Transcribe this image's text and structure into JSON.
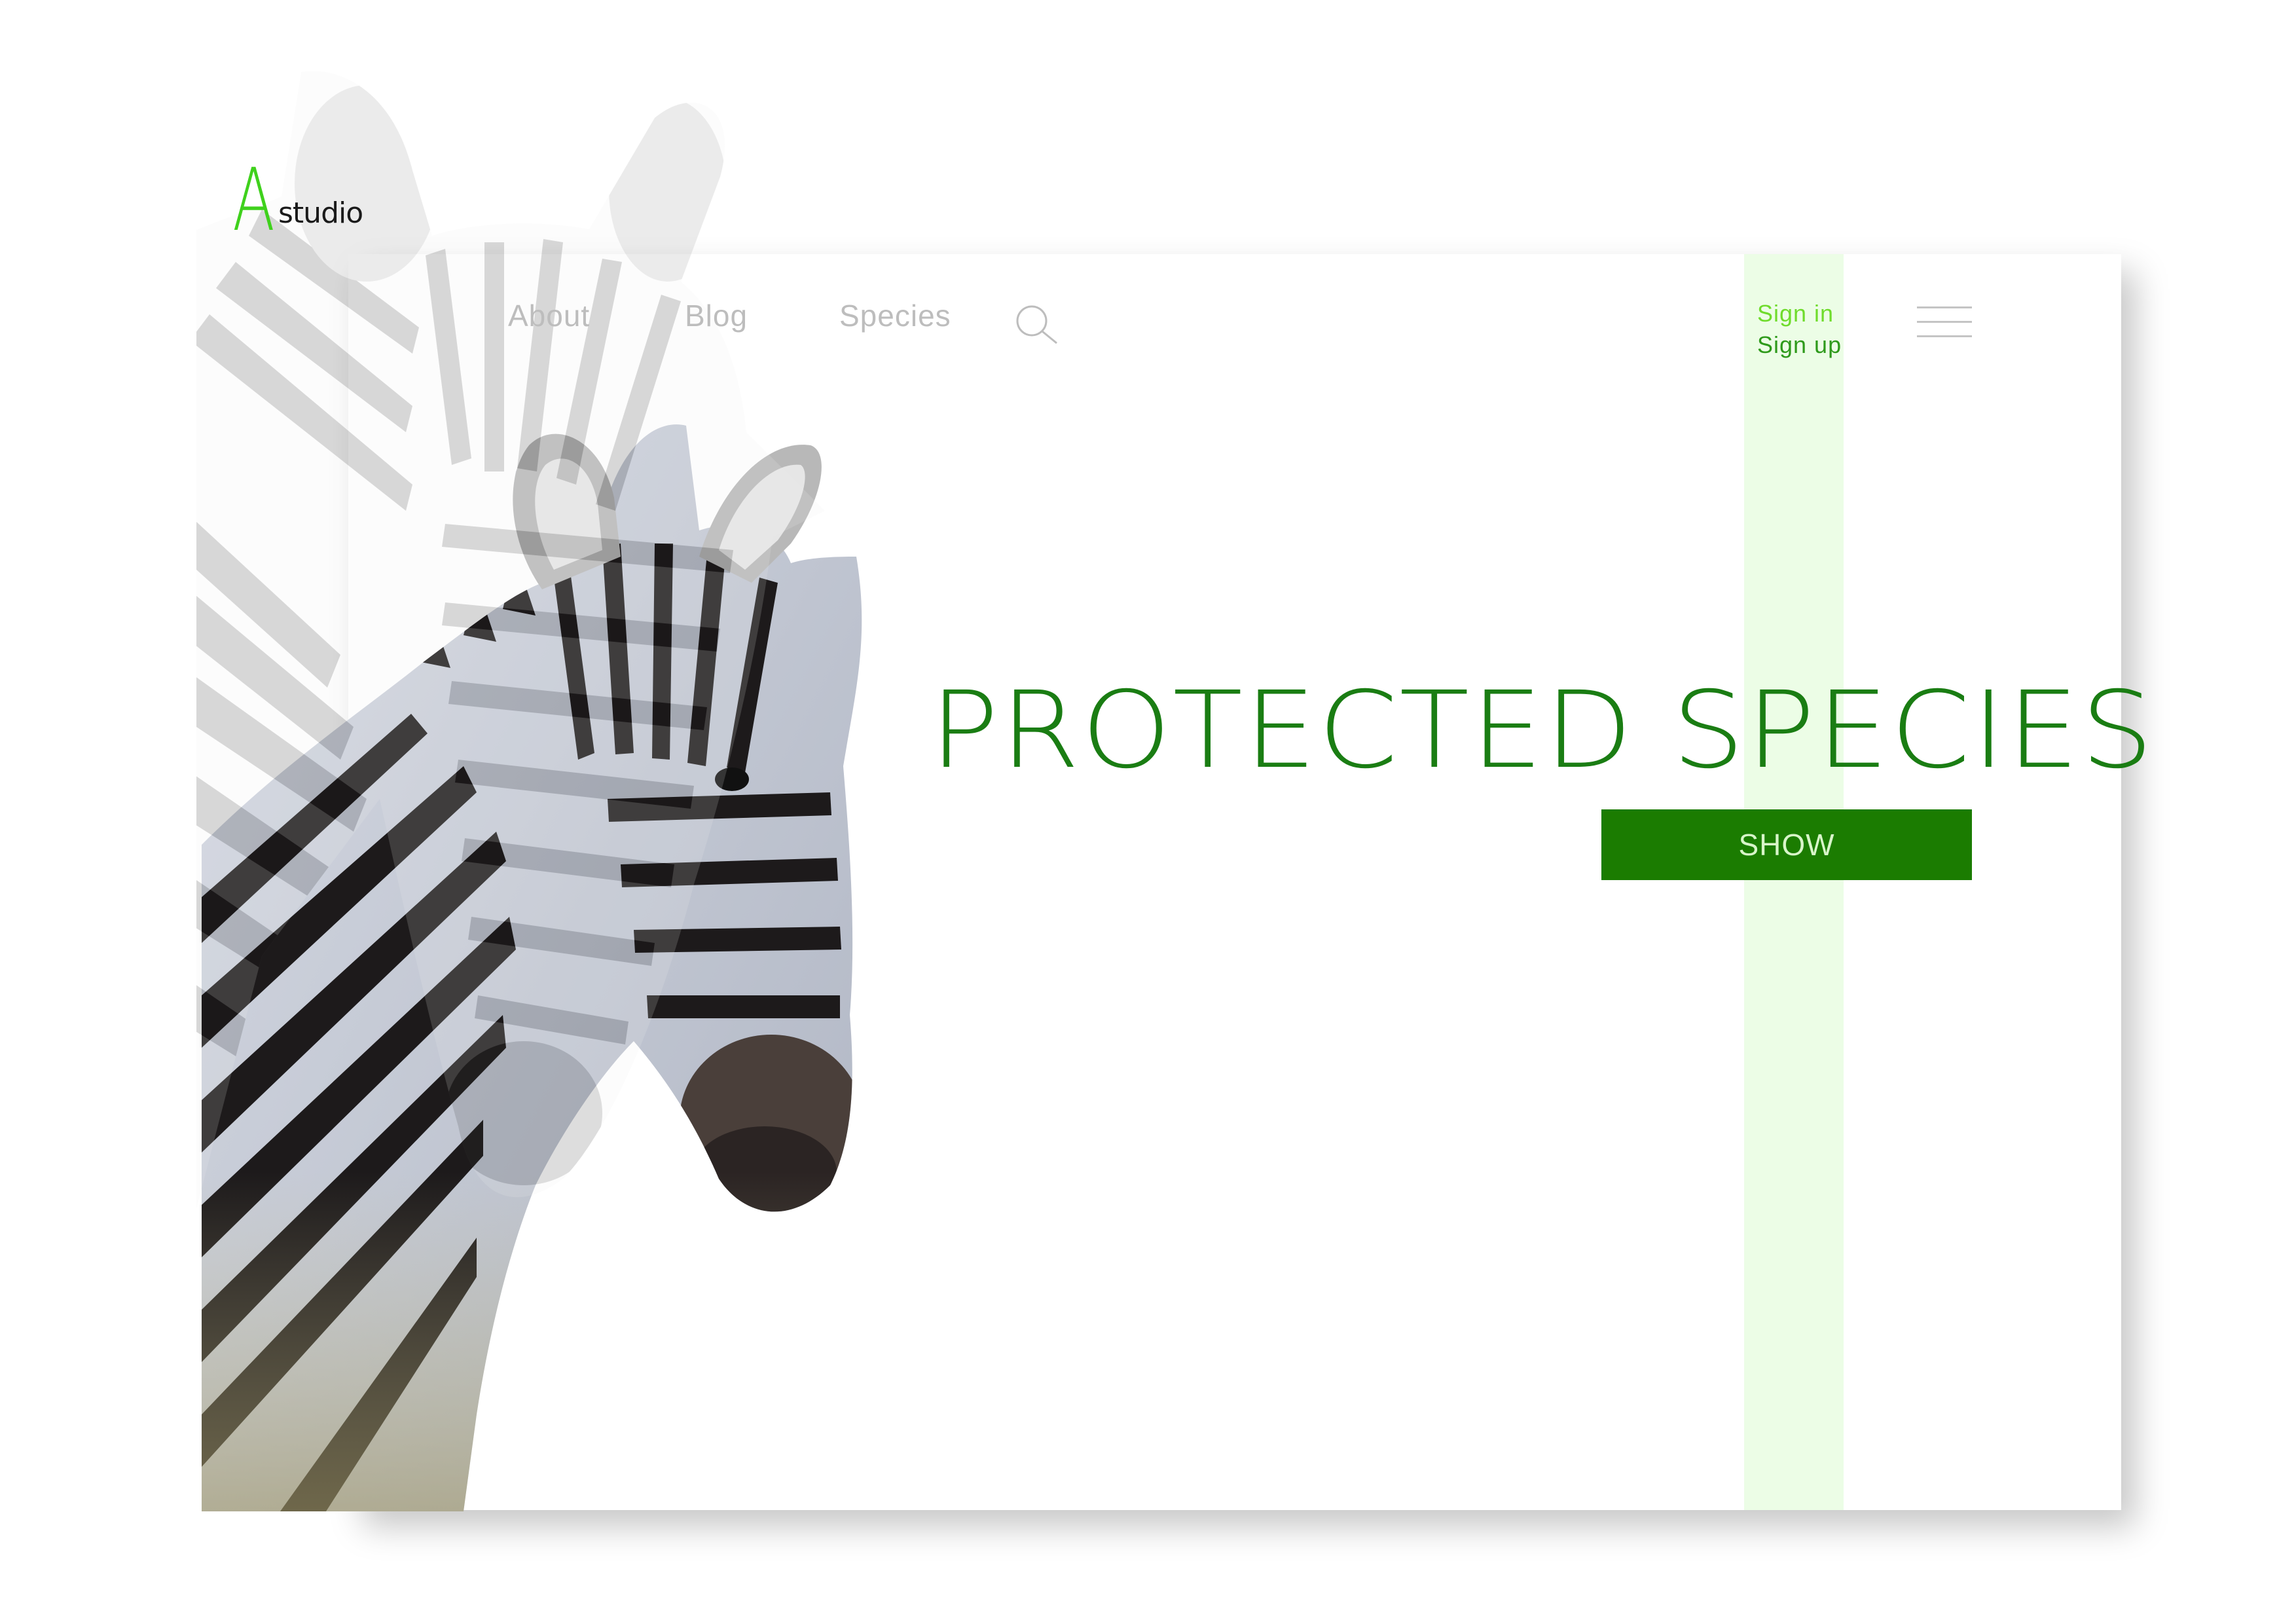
{
  "brand": {
    "logo_letter": "A",
    "logo_word": "studio",
    "accent_color": "#3fd11c"
  },
  "nav": {
    "items": [
      {
        "label": "About"
      },
      {
        "label": "Blog"
      },
      {
        "label": "Species"
      }
    ],
    "search_icon": "search-icon",
    "menu_icon": "hamburger-menu-icon"
  },
  "auth": {
    "sign_in": "Sign in",
    "sign_up": "Sign up"
  },
  "hero": {
    "title": "PROTECTED SPECIES",
    "button_label": "SHOW",
    "title_color": "#1a7d13",
    "button_color": "#1b7c01",
    "highlight_stripe_color": "#ecfde6"
  },
  "imagery": {
    "main_photo": "zebra-photo",
    "background_photo": "faded-zebra-photo"
  }
}
